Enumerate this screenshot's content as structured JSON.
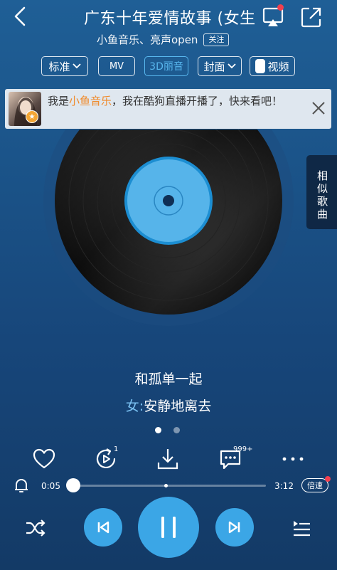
{
  "header": {
    "title": "广东十年爱情故事 (女生",
    "subtitle_artists": "小鱼音乐、亮声open",
    "follow_label": "关注"
  },
  "chips": {
    "quality": "标准",
    "mv": "MV",
    "three_d": "3D丽音",
    "cover": "封面",
    "video": "视频"
  },
  "banner": {
    "prefix": "我是",
    "highlight": "小鱼音乐",
    "suffix": "，我在酷狗直播开播了，快来看吧！"
  },
  "side_tab": {
    "label": "相似歌曲"
  },
  "lyrics": {
    "line1": "和孤单一起",
    "line2_who": "女:",
    "line2_text": "安静地离去"
  },
  "actions": {
    "recommend_count": "1",
    "comment_count": "999+"
  },
  "progress": {
    "current": "0:05",
    "total": "3:12",
    "fraction": 0.026
  },
  "speed_label": "倍速",
  "colors": {
    "accent": "#3ba6e6",
    "highlight": "#f08a2a",
    "badge_red": "#f2404f"
  }
}
